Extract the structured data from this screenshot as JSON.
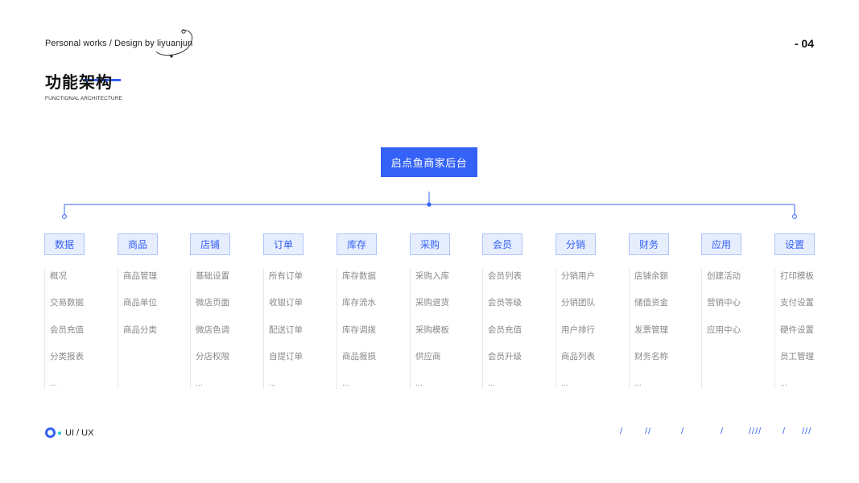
{
  "header": {
    "credit": "Personal works / Design by liyuanjun",
    "page_number": "- 04"
  },
  "title": {
    "main": "功能架构",
    "sub": "FUNCTIONAL ARCHITECTURE"
  },
  "root": {
    "label": "启点鱼商家后台"
  },
  "categories": [
    {
      "label": "数据",
      "items": [
        "概况",
        "交易数据",
        "会员充值",
        "分类报表",
        "..."
      ]
    },
    {
      "label": "商品",
      "items": [
        "商品管理",
        "商品单位",
        "商品分类"
      ]
    },
    {
      "label": "店铺",
      "items": [
        "基础设置",
        "微店页面",
        "微店色调",
        "分店权限",
        "..."
      ]
    },
    {
      "label": "订单",
      "items": [
        "所有订单",
        "收银订单",
        "配送订单",
        "自提订单",
        "..."
      ]
    },
    {
      "label": "库存",
      "items": [
        "库存数据",
        "库存流水",
        "库存调拨",
        "商品报损",
        "..."
      ]
    },
    {
      "label": "采购",
      "items": [
        "采购入库",
        "采购退货",
        "采购模板",
        "供应商",
        "..."
      ]
    },
    {
      "label": "会员",
      "items": [
        "会员列表",
        "会员等级",
        "会员充值",
        "会员升级",
        "..."
      ]
    },
    {
      "label": "分销",
      "items": [
        "分销用户",
        "分销团队",
        "用户排行",
        "商品列表",
        "..."
      ]
    },
    {
      "label": "财务",
      "items": [
        "店铺余额",
        "储值资金",
        "发票管理",
        "财务名称",
        "..."
      ]
    },
    {
      "label": "应用",
      "items": [
        "创建活动",
        "营销中心",
        "应用中心"
      ]
    },
    {
      "label": "设置",
      "items": [
        "打印模板",
        "支付设置",
        "硬件设置",
        "员工管理",
        "..."
      ]
    }
  ],
  "footer": {
    "label": "UI / UX",
    "slashes": [
      "/",
      "//",
      "/",
      "/",
      "////",
      "/",
      "///"
    ]
  },
  "colors": {
    "accent": "#3461f6",
    "tag_bg": "#e6eefe",
    "tag_border": "#aec3fb",
    "item_text": "#888888",
    "teal_dot": "#27c7d6"
  }
}
